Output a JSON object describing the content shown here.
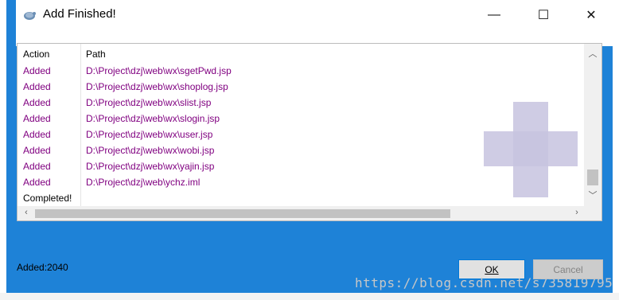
{
  "window": {
    "title": "Add Finished!",
    "minimize_glyph": "—",
    "maximize_glyph": "☐",
    "close_glyph": "✕"
  },
  "list": {
    "columns": {
      "action": "Action",
      "path": "Path"
    },
    "rows": [
      {
        "action": "Added",
        "path": "D:\\Project\\dzj\\web\\wx\\sgetPwd.jsp"
      },
      {
        "action": "Added",
        "path": "D:\\Project\\dzj\\web\\wx\\shoplog.jsp"
      },
      {
        "action": "Added",
        "path": "D:\\Project\\dzj\\web\\wx\\slist.jsp"
      },
      {
        "action": "Added",
        "path": "D:\\Project\\dzj\\web\\wx\\slogin.jsp"
      },
      {
        "action": "Added",
        "path": "D:\\Project\\dzj\\web\\wx\\user.jsp"
      },
      {
        "action": "Added",
        "path": "D:\\Project\\dzj\\web\\wx\\wobi.jsp"
      },
      {
        "action": "Added",
        "path": "D:\\Project\\dzj\\web\\wx\\yajin.jsp"
      },
      {
        "action": "Added",
        "path": "D:\\Project\\dzj\\web\\ychz.iml"
      },
      {
        "action": "Completed!",
        "path": ""
      }
    ]
  },
  "status": {
    "added": "Added:2040"
  },
  "buttons": {
    "ok": "OK",
    "cancel": "Cancel"
  },
  "watermark": "https://blog.csdn.net/s735819795",
  "colors": {
    "dialog_blue": "#1e82d7",
    "added_text": "#800080"
  }
}
